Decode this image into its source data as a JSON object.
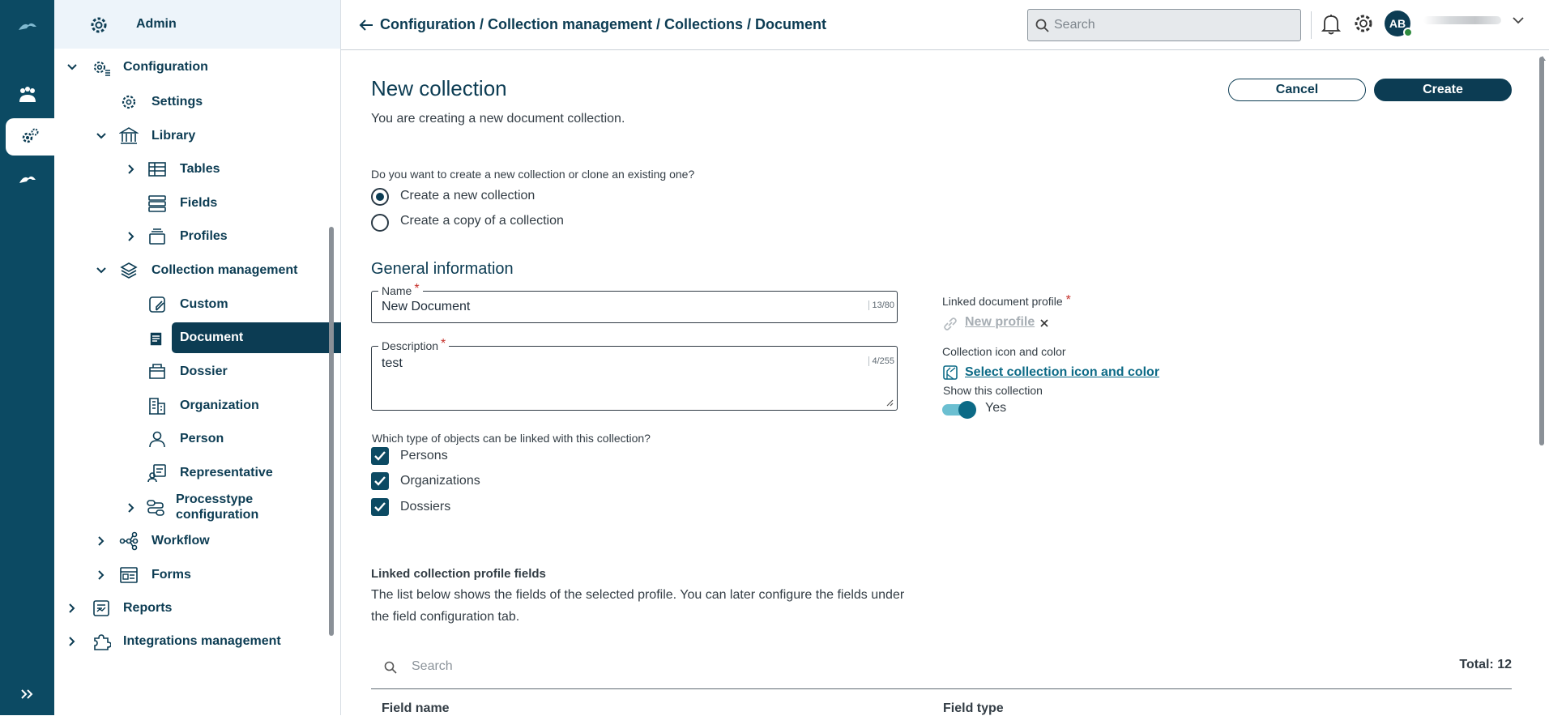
{
  "nav": {
    "header": "Admin",
    "items": {
      "configuration": "Configuration",
      "settings": "Settings",
      "library": "Library",
      "tables": "Tables",
      "fields": "Fields",
      "profiles": "Profiles",
      "collection_management": "Collection management",
      "custom": "Custom",
      "document": "Document",
      "dossier": "Dossier",
      "organization": "Organization",
      "person": "Person",
      "representative": "Representative",
      "processtype_line1": "Processtype",
      "processtype_line2": "configuration",
      "workflow": "Workflow",
      "forms": "Forms",
      "reports": "Reports",
      "integrations_management": "Integrations management"
    }
  },
  "topbar": {
    "breadcrumb": "Configuration / Collection management / Collections / Document",
    "search_placeholder": "Search",
    "avatar_initials": "AB"
  },
  "page": {
    "title": "New collection",
    "subtitle": "You are creating a new document collection.",
    "cancel_label": "Cancel",
    "create_label": "Create",
    "mode_question": "Do you want to create a new collection or clone an existing one?",
    "mode_options": [
      "Create a new collection",
      "Create a copy of a collection"
    ],
    "mode_selected": "Create a new collection",
    "general_heading": "General information",
    "name": {
      "label": "Name",
      "value": "New Document",
      "counter": "13/80",
      "required": "*"
    },
    "description": {
      "label": "Description",
      "value": "test",
      "counter": "4/255",
      "required": "*"
    },
    "linkable_question": "Which type of objects can be linked with this collection?",
    "linkable_options": [
      {
        "label": "Persons",
        "checked": true
      },
      {
        "label": "Organizations",
        "checked": true
      },
      {
        "label": "Dossiers",
        "checked": true
      }
    ],
    "linked_profile_label": "Linked document profile",
    "linked_profile_required": "*",
    "linked_profile_value": "New profile",
    "icon_color_label": "Collection icon and color",
    "icon_color_link": "Select collection icon and color",
    "show_label": "Show this collection",
    "show_value": "Yes",
    "show_enabled": true,
    "profile_fields_heading": "Linked collection profile fields",
    "profile_fields_text": "The list below shows the fields of the selected profile. You can later configure the fields under the field configuration tab.",
    "table_search_placeholder": "Search",
    "total_label": "Total: 12",
    "columns": [
      "Field name",
      "Field type"
    ]
  },
  "colors": {
    "primary": "#0c3c53",
    "rail": "#0c4a63",
    "accent": "#0c6a86",
    "required": "#c6312b"
  }
}
